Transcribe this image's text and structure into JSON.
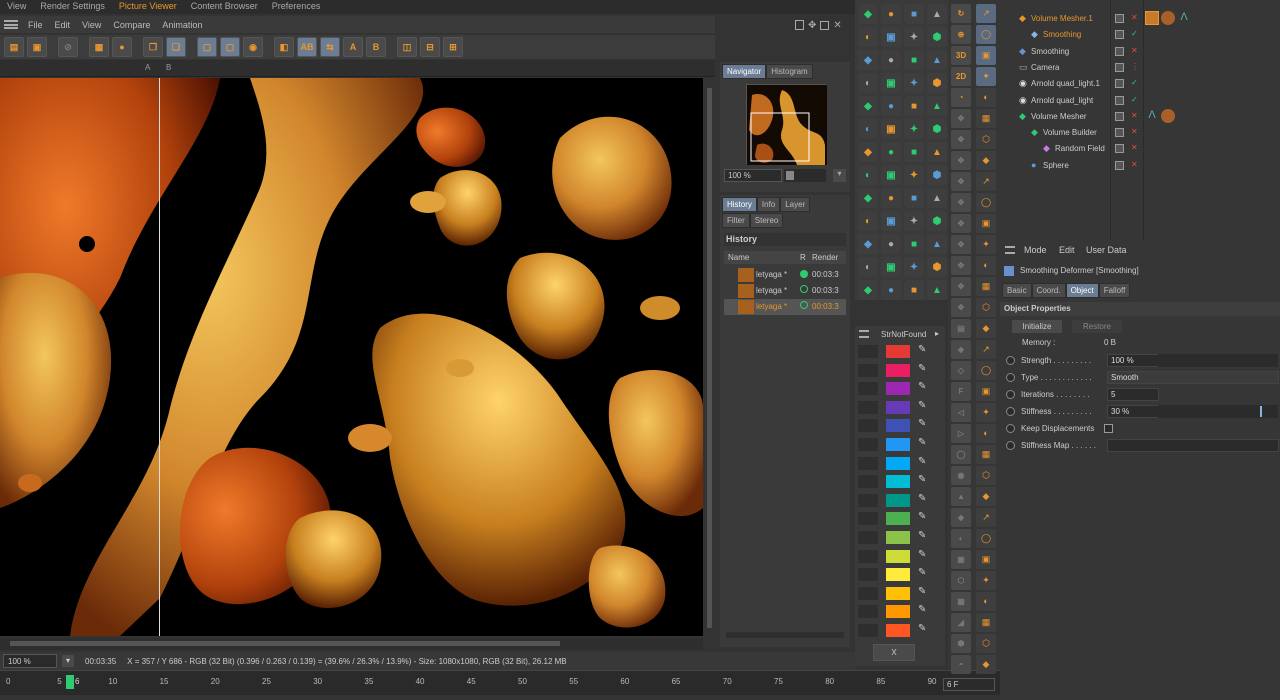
{
  "top_menu": {
    "items": [
      "View",
      "Render Settings",
      "Picture Viewer",
      "Content Browser",
      "Preferences"
    ],
    "active": "Picture Viewer"
  },
  "menu_bar": {
    "items": [
      "File",
      "Edit",
      "View",
      "Compare",
      "Animation"
    ]
  },
  "ruler": {
    "a_label": "A",
    "b_label": "B"
  },
  "toolbar": {
    "ab_label": "AB",
    "a_label": "A",
    "b_label": "B"
  },
  "navigator": {
    "tabs": [
      "Navigator",
      "Histogram"
    ],
    "zoom": "100 %"
  },
  "history": {
    "tabs": [
      "History",
      "Info",
      "Layer"
    ],
    "tabs2": [
      "Filter",
      "Stereo"
    ],
    "title": "History",
    "columns": [
      "Name",
      "R",
      "Render"
    ],
    "rows": [
      {
        "name": "letyaga *",
        "time": "00:03:3"
      },
      {
        "name": "letyaga *",
        "time": "00:03:3"
      },
      {
        "name": "letyaga *",
        "time": "00:03:3"
      }
    ]
  },
  "status": {
    "zoom": "100 %",
    "time": "00:03:35",
    "info": "X = 357 / Y 686 - RGB (32 Bit) (0.396 / 0.263 / 0.139) = (39.6% / 26.3% / 13.9%) - Size: 1080x1080, RGB (32 Bit), 26.12 MB"
  },
  "timeline": {
    "ticks": [
      "0",
      "5",
      "10",
      "15",
      "20",
      "25",
      "30",
      "35",
      "40",
      "45",
      "50",
      "55",
      "60",
      "65",
      "70",
      "75",
      "80",
      "85",
      "90"
    ],
    "current": "6",
    "frame_field": "6 F"
  },
  "palette": {
    "title": "StrNotFound",
    "x_label": "X",
    "colors": [
      "#e53935",
      "#e91e63",
      "#9c27b0",
      "#673ab7",
      "#3f51b5",
      "#2196f3",
      "#03a9f4",
      "#00bcd4",
      "#009688",
      "#4caf50",
      "#8bc34a",
      "#cddc39",
      "#ffeb3b",
      "#ffc107",
      "#ff9800",
      "#ff5722"
    ]
  },
  "object_manager": {
    "objects": [
      {
        "name": "Volume Mesher.1",
        "color": "#e8962e"
      },
      {
        "name": "Smoothing",
        "color": "#e8962e"
      },
      {
        "name": "Smoothing",
        "color": "#cccccc"
      },
      {
        "name": "Camera",
        "color": "#cccccc"
      },
      {
        "name": "Arnold quad_light.1",
        "color": "#cccccc"
      },
      {
        "name": "Arnold quad_light",
        "color": "#cccccc"
      },
      {
        "name": "Volume Mesher",
        "color": "#cccccc"
      },
      {
        "name": "Volume Builder",
        "color": "#cccccc"
      },
      {
        "name": "Random Field",
        "color": "#cccccc"
      },
      {
        "name": "Sphere",
        "color": "#cccccc"
      }
    ]
  },
  "attributes": {
    "menu": [
      "Mode",
      "Edit",
      "User Data"
    ],
    "title": "Smoothing Deformer [Smoothing]",
    "tabs": [
      "Basic",
      "Coord.",
      "Object",
      "Falloff"
    ],
    "active_tab": "Object",
    "section": "Object Properties",
    "initialize": "Initialize",
    "restore": "Restore",
    "memory_label": "Memory :",
    "memory_value": "0 B",
    "fields": [
      {
        "label": "Strength . . . . . . . . .",
        "value": "100 %"
      },
      {
        "label": "Type . . . . . . . . . . . .",
        "value": "Smooth"
      },
      {
        "label": "Iterations . . . . . . . .",
        "value": "5"
      },
      {
        "label": "Stiffness . . . . . . . . .",
        "value": "30 %"
      },
      {
        "label": "Keep Displacements",
        "value": ""
      },
      {
        "label": "Stiffness Map . . . . . .",
        "value": ""
      }
    ]
  }
}
